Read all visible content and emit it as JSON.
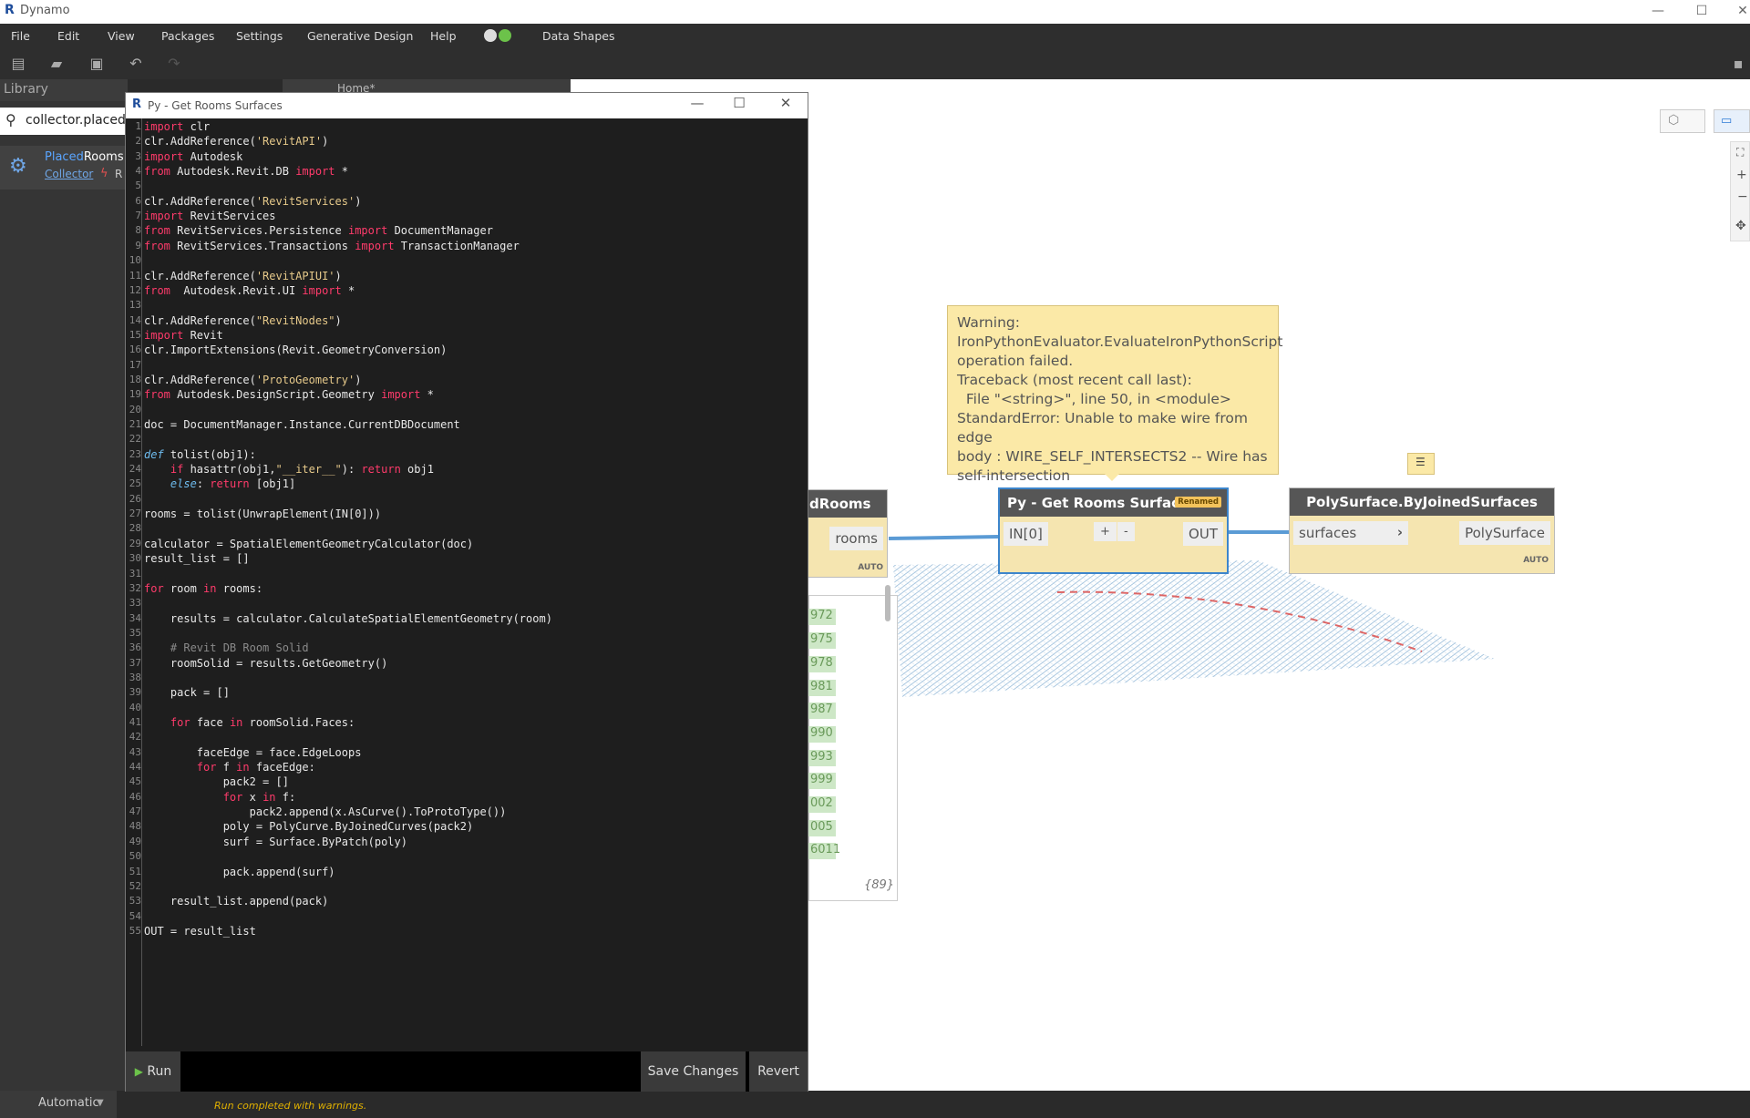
{
  "window": {
    "title": "Dynamo",
    "controls": [
      "—",
      "☐",
      "✕"
    ]
  },
  "menu": {
    "items": [
      "File",
      "Edit",
      "View",
      "Packages",
      "Settings",
      "Generative Design",
      "Help",
      "Data Shapes"
    ]
  },
  "library": {
    "header": "Library",
    "search_value": "collector.placed",
    "result": {
      "name_highlight": "Placed",
      "name_rest": "Rooms",
      "category": "Collector",
      "extra": "R"
    }
  },
  "workspace": {
    "tab_label": "Home*"
  },
  "editor": {
    "title": "Py - Get Rooms Surfaces",
    "buttons": {
      "run": "Run",
      "save": "Save Changes",
      "revert": "Revert"
    },
    "code_lines": [
      "import clr",
      "clr.AddReference('RevitAPI')",
      "import Autodesk",
      "from Autodesk.Revit.DB import *",
      "",
      "clr.AddReference('RevitServices')",
      "import RevitServices",
      "from RevitServices.Persistence import DocumentManager",
      "from RevitServices.Transactions import TransactionManager",
      "",
      "clr.AddReference('RevitAPIUI')",
      "from  Autodesk.Revit.UI import *",
      "",
      "clr.AddReference(\"RevitNodes\")",
      "import Revit",
      "clr.ImportExtensions(Revit.GeometryConversion)",
      "",
      "clr.AddReference('ProtoGeometry')",
      "from Autodesk.DesignScript.Geometry import *",
      "",
      "doc = DocumentManager.Instance.CurrentDBDocument",
      "",
      "def tolist(obj1):",
      "    if hasattr(obj1,\"__iter__\"): return obj1",
      "    else: return [obj1]",
      "",
      "rooms = tolist(UnwrapElement(IN[0]))",
      "",
      "calculator = SpatialElementGeometryCalculator(doc)",
      "result_list = []",
      "",
      "for room in rooms:",
      "",
      "    results = calculator.CalculateSpatialElementGeometry(room)",
      "",
      "    # Revit DB Room Solid",
      "    roomSolid = results.GetGeometry()",
      "",
      "    pack = []",
      "",
      "    for face in roomSolid.Faces:",
      "",
      "        faceEdge = face.EdgeLoops",
      "        for f in faceEdge:",
      "            pack2 = []",
      "            for x in f:",
      "                pack2.append(x.AsCurve().ToProtoType())",
      "            poly = PolyCurve.ByJoinedCurves(pack2)",
      "            surf = Surface.ByPatch(poly)",
      "",
      "            pack.append(surf)",
      "",
      "    result_list.append(pack)",
      "",
      "OUT = result_list"
    ]
  },
  "nodes": {
    "rooms_node": {
      "title": "dRooms",
      "output": "rooms",
      "auto": "AUTO",
      "list_items": [
        "972",
        "975",
        "978",
        "981",
        "987",
        "990",
        "993",
        "999",
        "002",
        "005",
        "6011"
      ],
      "count": "{89}"
    },
    "python_node": {
      "title": "Py - Get Rooms Surfaces",
      "badge": "Renamed",
      "input": "IN[0]",
      "plus": "+",
      "minus": "-",
      "output": "OUT"
    },
    "polysurface_node": {
      "title": "PolySurface.ByJoinedSurfaces",
      "input": "surfaces",
      "output": "PolySurface",
      "auto": "AUTO"
    }
  },
  "warning": {
    "lines": [
      "Warning:",
      "IronPythonEvaluator.EvaluateIronPythonScript",
      "operation failed.",
      "Traceback (most recent call last):",
      "  File \"<string>\", line 50, in <module>",
      "StandardError: Unable to make wire from edge",
      "body : WIRE_SELF_INTERSECTS2 -- Wire has",
      "self-intersection"
    ]
  },
  "status": {
    "run_mode": "Automatic",
    "message": "Run completed with warnings."
  }
}
